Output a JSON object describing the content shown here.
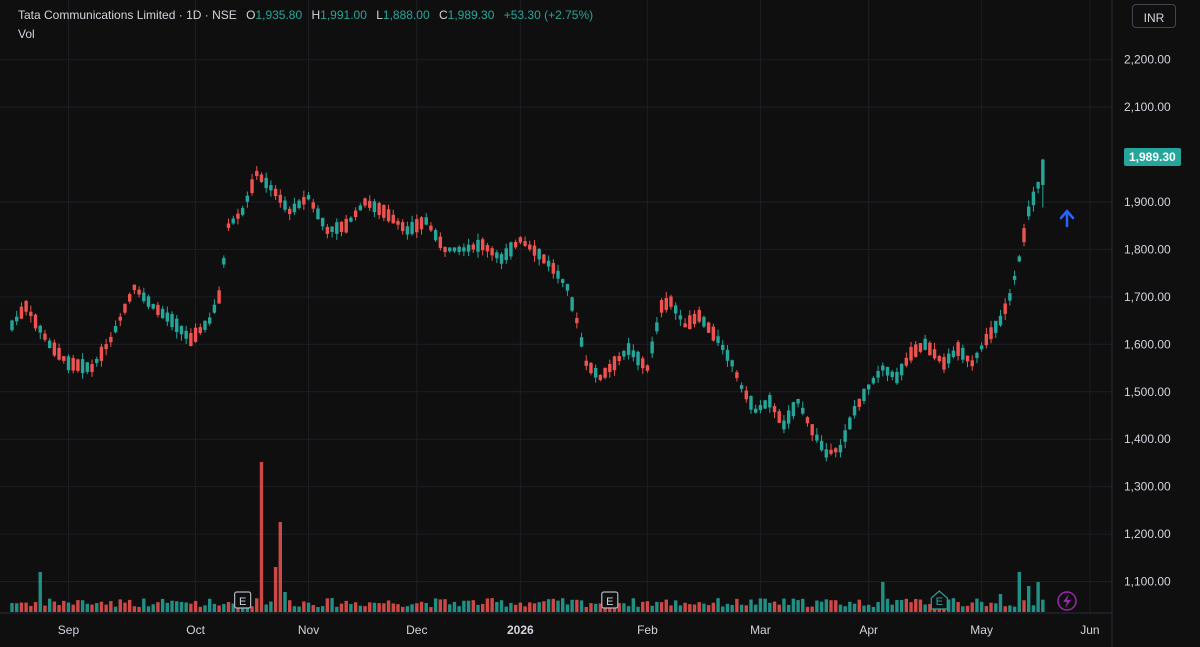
{
  "header": {
    "symbol": "Tata Communications Limited · 1D · NSE",
    "open_label": "O",
    "open": "1,935.80",
    "high_label": "H",
    "high": "1,991.00",
    "low_label": "L",
    "low": "1,888.00",
    "close_label": "C",
    "close": "1,989.30",
    "change": "+53.30 (+2.75%)",
    "volume_label": "Vol"
  },
  "toolbar": {
    "currency": "INR"
  },
  "price_scale": {
    "labels": [
      "2,200.00",
      "2,100.00",
      "1,900.00",
      "1,800.00",
      "1,700.00",
      "1,600.00",
      "1,500.00",
      "1,400.00",
      "1,300.00",
      "1,200.00",
      "1,100.00"
    ],
    "last_price": "1,989.30"
  },
  "colors": {
    "up": "#26a69a",
    "down": "#ef5350",
    "vol_up": "#26a69a",
    "vol_down": "#ef5350",
    "alert": "#2962ff",
    "lightning": "#9c27b0"
  },
  "chart_data": {
    "type": "candlestick",
    "title": "Tata Communications Limited · 1D · NSE",
    "ylim": [
      1000,
      2250
    ],
    "months": [
      "Sep",
      "Oct",
      "Nov",
      "Dec",
      "2026",
      "Feb",
      "Mar",
      "Apr",
      "May",
      "Jun"
    ],
    "earnings_markers": [
      "E",
      "E",
      "E"
    ],
    "ohlc_keypoints": [
      [
        0,
        1640
      ],
      [
        3,
        1680
      ],
      [
        8,
        1600
      ],
      [
        12,
        1560
      ],
      [
        17,
        1550
      ],
      [
        21,
        1610
      ],
      [
        26,
        1720
      ],
      [
        30,
        1680
      ],
      [
        34,
        1650
      ],
      [
        38,
        1610
      ],
      [
        42,
        1650
      ],
      [
        44,
        1700
      ],
      [
        46,
        1850
      ],
      [
        49,
        1880
      ],
      [
        52,
        1960
      ],
      [
        56,
        1920
      ],
      [
        59,
        1880
      ],
      [
        63,
        1910
      ],
      [
        67,
        1840
      ],
      [
        71,
        1850
      ],
      [
        75,
        1900
      ],
      [
        79,
        1880
      ],
      [
        84,
        1840
      ],
      [
        88,
        1860
      ],
      [
        92,
        1800
      ],
      [
        96,
        1800
      ],
      [
        100,
        1810
      ],
      [
        104,
        1780
      ],
      [
        108,
        1820
      ],
      [
        112,
        1790
      ],
      [
        115,
        1760
      ],
      [
        118,
        1720
      ],
      [
        120,
        1650
      ],
      [
        122,
        1560
      ],
      [
        125,
        1530
      ],
      [
        128,
        1560
      ],
      [
        131,
        1590
      ],
      [
        135,
        1550
      ],
      [
        138,
        1680
      ],
      [
        140,
        1690
      ],
      [
        143,
        1640
      ],
      [
        146,
        1660
      ],
      [
        150,
        1610
      ],
      [
        153,
        1560
      ],
      [
        155,
        1510
      ],
      [
        158,
        1460
      ],
      [
        161,
        1480
      ],
      [
        164,
        1430
      ],
      [
        167,
        1480
      ],
      [
        170,
        1420
      ],
      [
        173,
        1370
      ],
      [
        176,
        1380
      ],
      [
        179,
        1460
      ],
      [
        182,
        1510
      ],
      [
        185,
        1550
      ],
      [
        188,
        1530
      ],
      [
        191,
        1580
      ],
      [
        194,
        1600
      ],
      [
        198,
        1560
      ],
      [
        201,
        1590
      ],
      [
        204,
        1560
      ],
      [
        207,
        1610
      ],
      [
        210,
        1650
      ],
      [
        212,
        1700
      ],
      [
        214,
        1780
      ],
      [
        216,
        1880
      ],
      [
        218,
        1935
      ],
      [
        219,
        1989
      ]
    ],
    "last_candle": {
      "open": 1935.8,
      "high": 1991.0,
      "low": 1888.0,
      "close": 1989.3
    },
    "volume_spikes": [
      [
        6,
        4.0
      ],
      [
        53,
        15.0
      ],
      [
        56,
        4.5
      ],
      [
        57,
        9.0
      ],
      [
        58,
        2.0
      ],
      [
        185,
        3.0
      ],
      [
        210,
        1.8
      ],
      [
        214,
        4.0
      ],
      [
        216,
        2.6
      ],
      [
        218,
        3.0
      ]
    ]
  }
}
